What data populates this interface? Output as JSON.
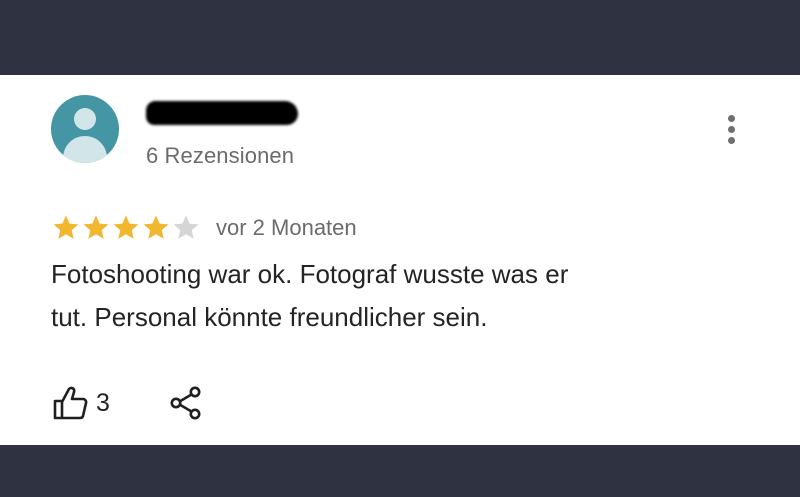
{
  "colors": {
    "background_dark": "#2f3240",
    "card": "#ffffff",
    "avatar": "#4496a5",
    "star_filled": "#f0b72f",
    "star_empty": "#d5d5d5",
    "text_primary": "#242424",
    "text_secondary": "#6b6b6b"
  },
  "reviewer": {
    "name_redacted": true,
    "reviews_count": "6 Rezensionen",
    "avatar_icon": "person-icon"
  },
  "review": {
    "rating": 4,
    "max_rating": 5,
    "date": "vor 2 Monaten",
    "text_line1": "Fotoshooting war ok. Fotograf wusste was er",
    "text_line2": "tut. Personal könnte freundlicher sein."
  },
  "actions": {
    "like_icon": "thumbs-up-icon",
    "like_count": "3",
    "share_icon": "share-icon",
    "menu_icon": "more-vertical-icon"
  }
}
